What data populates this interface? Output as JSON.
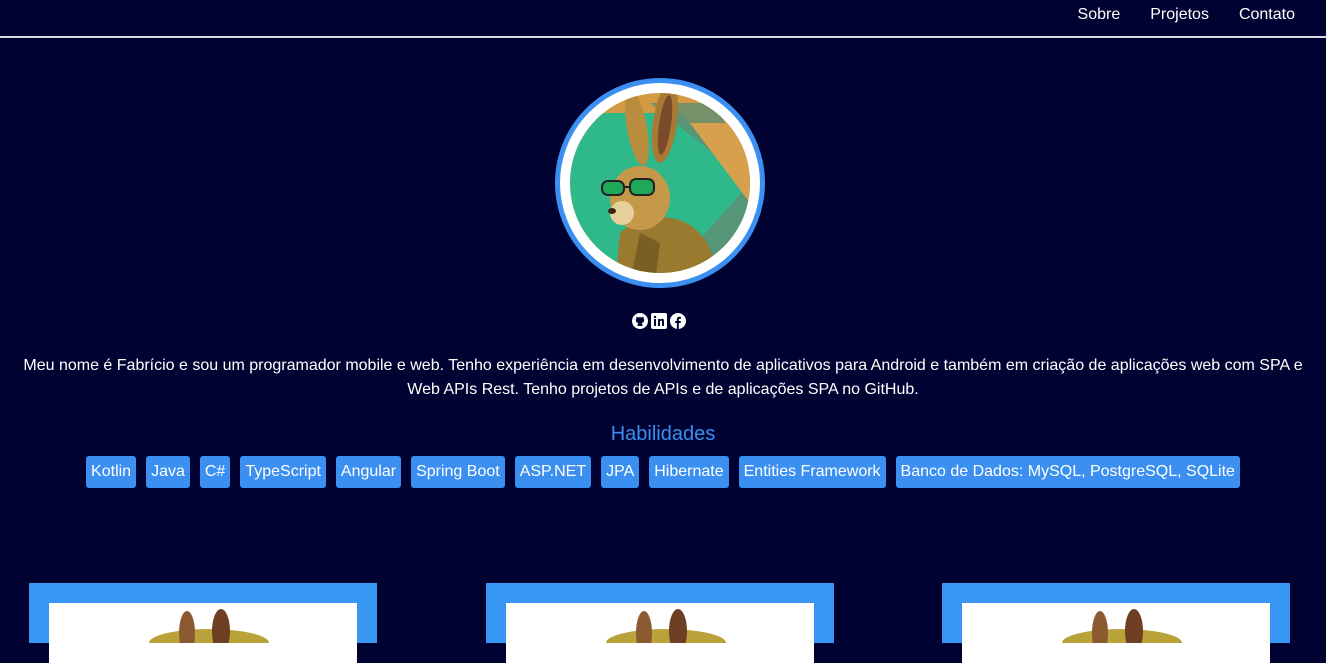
{
  "nav": {
    "items": [
      "Sobre",
      "Projetos",
      "Contato"
    ]
  },
  "profile": {
    "avatar_icon": "rabbit-with-sunglasses-avatar",
    "socials": [
      {
        "icon": "github-icon"
      },
      {
        "icon": "linkedin-icon"
      },
      {
        "icon": "facebook-icon"
      }
    ]
  },
  "about": {
    "bio": "Meu nome é Fabrício e sou um programador mobile e web. Tenho experiência em desenvolvimento de aplicativos para Android e também em criação de aplicações web com SPA e Web APIs Rest. Tenho projetos de APIs e de aplicações SPA no GitHub."
  },
  "skills": {
    "title": "Habilidades",
    "items": [
      "Kotlin",
      "Java",
      "C#",
      "TypeScript",
      "Angular",
      "Spring Boot",
      "ASP.NET",
      "JPA",
      "Hibernate",
      "Entities Framework",
      "Banco de Dados: MySQL, PostgreSQL, SQLite"
    ]
  },
  "colors": {
    "background": "#000231",
    "accent": "#3a8ff0",
    "card": "#3896f4",
    "text": "#ffffff"
  }
}
